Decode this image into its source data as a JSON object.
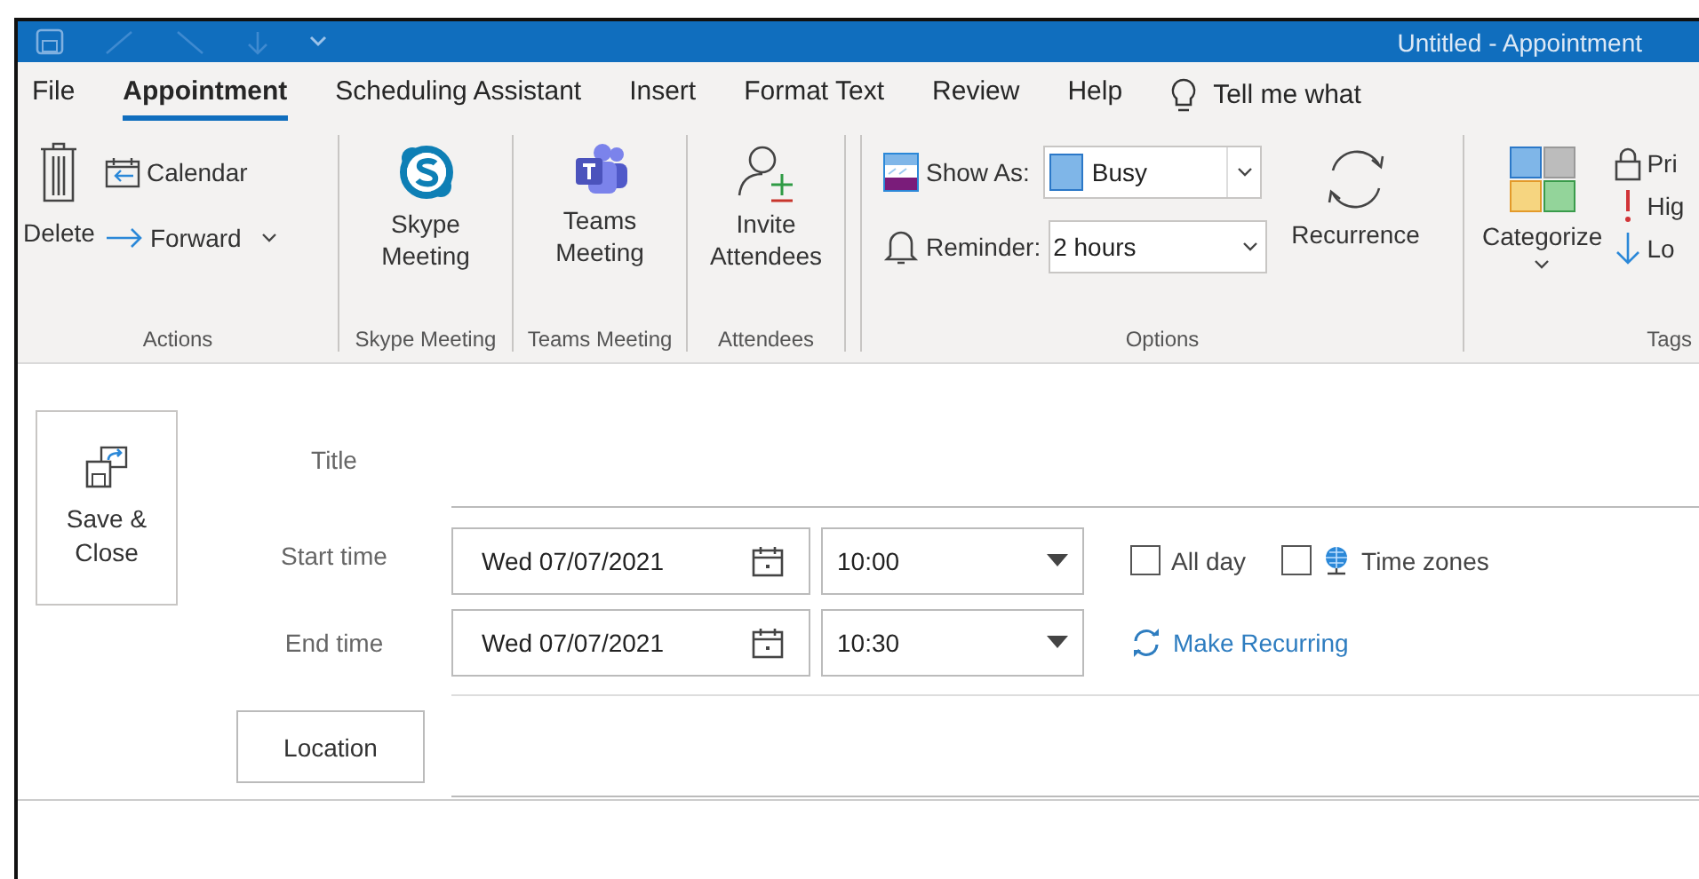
{
  "window": {
    "title": "Untitled - Appointment"
  },
  "menu_tabs": [
    {
      "label": "File",
      "selected": false
    },
    {
      "label": "Appointment",
      "selected": true
    },
    {
      "label": "Scheduling Assistant",
      "selected": false
    },
    {
      "label": "Insert",
      "selected": false
    },
    {
      "label": "Format Text",
      "selected": false
    },
    {
      "label": "Review",
      "selected": false
    },
    {
      "label": "Help",
      "selected": false
    }
  ],
  "tell_me": "Tell me what",
  "ribbon": {
    "actions": {
      "delete": "Delete",
      "calendar": "Calendar",
      "forward": "Forward",
      "label": "Actions"
    },
    "skype": {
      "button": "Skype Meeting",
      "label": "Skype Meeting"
    },
    "teams": {
      "button": "Teams Meeting",
      "label": "Teams Meeting"
    },
    "attendees": {
      "button": "Invite Attendees",
      "label": "Attendees"
    },
    "options": {
      "show_as": {
        "label": "Show As:",
        "value": "Busy",
        "color": "#7fb6e8"
      },
      "reminder": {
        "label": "Reminder:",
        "value": "2 hours"
      },
      "recurrence": "Recurrence",
      "label": "Options"
    },
    "tags": {
      "categorize": "Categorize",
      "private": "Pri",
      "high": "Hig",
      "low": "Lo",
      "label": "Tags"
    }
  },
  "form": {
    "save_close": "Save & Close",
    "title": {
      "label": "Title"
    },
    "start": {
      "label": "Start time",
      "date": "Wed 07/07/2021",
      "time": "10:00"
    },
    "end": {
      "label": "End time",
      "date": "Wed 07/07/2021",
      "time": "10:30"
    },
    "all_day": {
      "label": "All day",
      "checked": false
    },
    "time_zones": {
      "label": "Time zones",
      "checked": false
    },
    "make_recurring": "Make Recurring",
    "location": "Location"
  }
}
